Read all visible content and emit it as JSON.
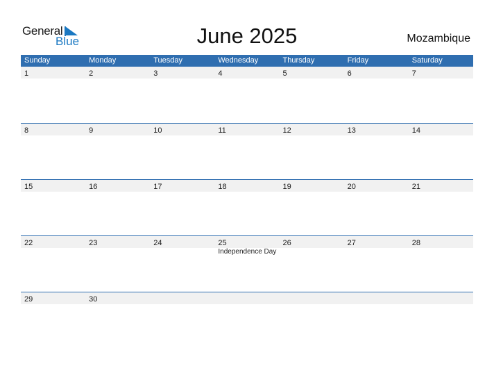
{
  "logo": {
    "word1": "General",
    "word2": "Blue"
  },
  "title": "June 2025",
  "country": "Mozambique",
  "colors": {
    "header_bg": "#2f6eb0",
    "date_strip_bg": "#f1f1f1",
    "brand_blue": "#1a78c2"
  },
  "weekdays": [
    "Sunday",
    "Monday",
    "Tuesday",
    "Wednesday",
    "Thursday",
    "Friday",
    "Saturday"
  ],
  "weeks": [
    {
      "days": [
        {
          "num": "1"
        },
        {
          "num": "2"
        },
        {
          "num": "3"
        },
        {
          "num": "4"
        },
        {
          "num": "5"
        },
        {
          "num": "6"
        },
        {
          "num": "7"
        }
      ]
    },
    {
      "days": [
        {
          "num": "8"
        },
        {
          "num": "9"
        },
        {
          "num": "10"
        },
        {
          "num": "11"
        },
        {
          "num": "12"
        },
        {
          "num": "13"
        },
        {
          "num": "14"
        }
      ]
    },
    {
      "days": [
        {
          "num": "15"
        },
        {
          "num": "16"
        },
        {
          "num": "17"
        },
        {
          "num": "18"
        },
        {
          "num": "19"
        },
        {
          "num": "20"
        },
        {
          "num": "21"
        }
      ]
    },
    {
      "days": [
        {
          "num": "22"
        },
        {
          "num": "23"
        },
        {
          "num": "24"
        },
        {
          "num": "25",
          "event": "Independence Day"
        },
        {
          "num": "26"
        },
        {
          "num": "27"
        },
        {
          "num": "28"
        }
      ]
    },
    {
      "days": [
        {
          "num": "29"
        },
        {
          "num": "30"
        },
        {
          "num": ""
        },
        {
          "num": ""
        },
        {
          "num": ""
        },
        {
          "num": ""
        },
        {
          "num": ""
        }
      ]
    }
  ]
}
